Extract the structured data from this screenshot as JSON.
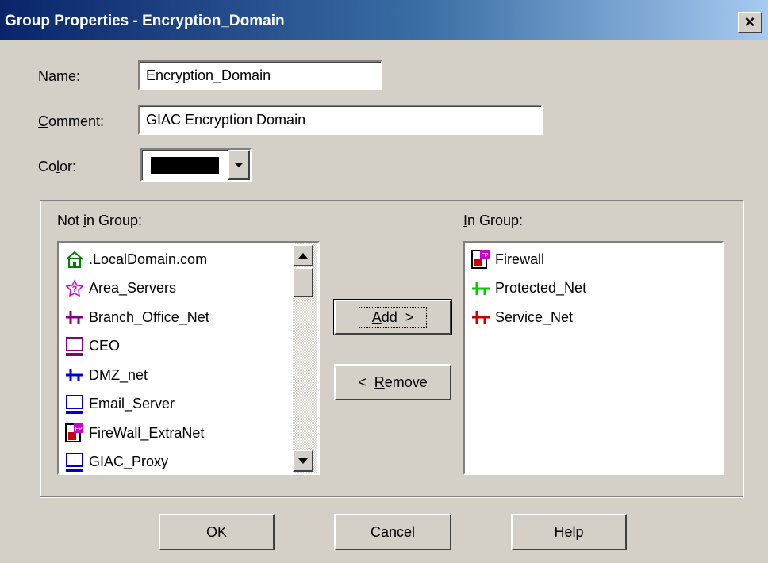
{
  "window": {
    "title": "Group Properties - Encryption_Domain",
    "close_label": "×"
  },
  "form": {
    "name_label_mnemonic": "N",
    "name_label_rest": "ame:",
    "name_value": "Encryption_Domain",
    "comment_label_mnemonic": "C",
    "comment_label_rest": "omment:",
    "comment_value": "GIAC Encryption Domain",
    "color_label_pre": "Co",
    "color_label_mnemonic": "l",
    "color_label_rest": "or:",
    "color_value": "#000000"
  },
  "not_in_group": {
    "label_pre": "Not ",
    "label_mnemonic": "i",
    "label_rest": "n Group:",
    "items": [
      {
        "label": ".LocalDomain.com",
        "icon": "domain-house-icon"
      },
      {
        "label": "Area_Servers",
        "icon": "group-question-icon"
      },
      {
        "label": "Branch_Office_Net",
        "icon": "network-icon"
      },
      {
        "label": "CEO",
        "icon": "workstation-icon"
      },
      {
        "label": "DMZ_net",
        "icon": "network-icon"
      },
      {
        "label": "Email_Server",
        "icon": "workstation-icon"
      },
      {
        "label": "FireWall_ExtraNet",
        "icon": "firewall-icon"
      },
      {
        "label": "GIAC_Proxy",
        "icon": "workstation-icon"
      }
    ]
  },
  "in_group": {
    "label_mnemonic": "I",
    "label_rest": "n Group:",
    "items": [
      {
        "label": "Firewall",
        "icon": "firewall-icon"
      },
      {
        "label": "Protected_Net",
        "icon": "network-icon"
      },
      {
        "label": "Service_Net",
        "icon": "network-icon"
      }
    ]
  },
  "buttons": {
    "add_mnemonic": "A",
    "add_rest": "dd  >",
    "remove_pre": "<  ",
    "remove_mnemonic": "R",
    "remove_rest": "emove",
    "ok": "OK",
    "cancel": "Cancel",
    "help_mnemonic": "H",
    "help_rest": "elp"
  },
  "colors": {
    "domain_icon": "#008000",
    "group_icon": "#cc00cc",
    "branch_net": "#800080",
    "dmz_net": "#0000cc",
    "protected_net": "#00cc00",
    "service_net": "#cc0000",
    "ceo_station": "#800080",
    "email_station": "#0000cc",
    "proxy_station": "#0000cc"
  }
}
